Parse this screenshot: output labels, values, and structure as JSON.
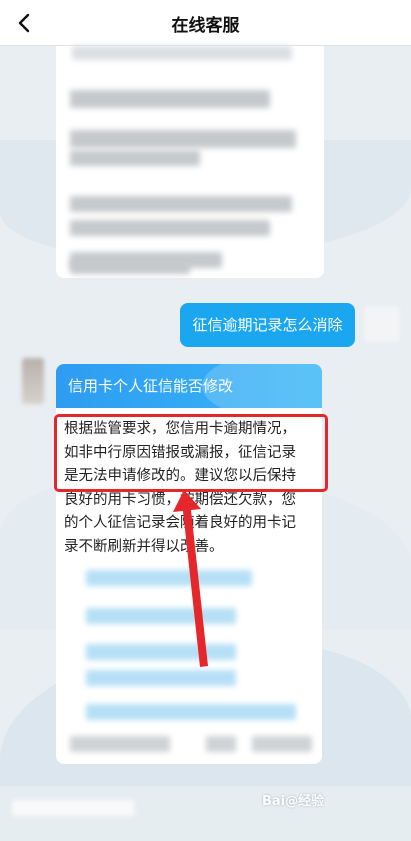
{
  "header": {
    "title": "在线客服"
  },
  "conversation": {
    "user_message": "征信逾期记录怎么消除",
    "agent_card": {
      "header": "信用卡个人征信能否修改",
      "lines": [
        "根据监管要求，您信用卡逾期情况，",
        "如非中行原因错报或漏报，征信记录",
        "是无法申请修改的。建议您以后保持",
        "良好的用卡习惯，按期偿还欠款，您",
        "的个人征信记录会随着良好的用卡记",
        "录不断刷新并得以改善。"
      ]
    }
  },
  "annotation": {
    "color": "#e5262b"
  },
  "theme": {
    "accent": "#1ba7f0",
    "background": "#e9eef2"
  },
  "icons": {
    "back": "chevron-left-icon"
  },
  "watermark": "Bai@经验"
}
